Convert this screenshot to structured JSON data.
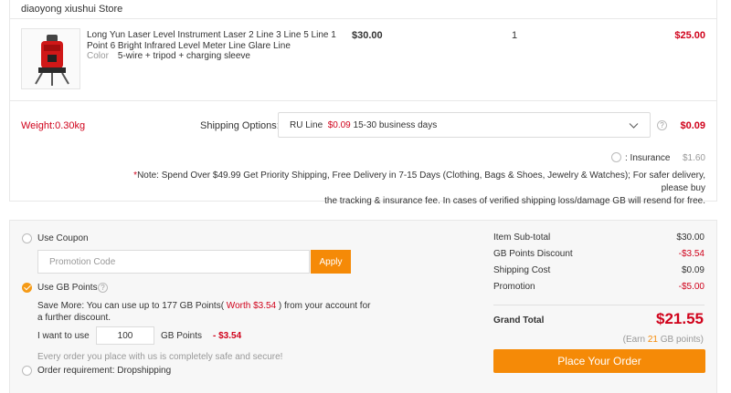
{
  "store": {
    "name": "diaoyong xiushui Store"
  },
  "product": {
    "title": "Long Yun Laser Level Instrument Laser 2 Line 3 Line 5 Line 1 Point 6 Bright Infrared Level Meter Line Glare Line",
    "option_label": "Color",
    "option_value": "5-wire + tripod + charging sleeve",
    "price": "$30.00",
    "quantity": "1",
    "total": "$25.00",
    "thumbnail_icon": "laser-level-image"
  },
  "shipping": {
    "weight": "Weight:0.30kg",
    "label": "Shipping Options:",
    "method": "RU Line",
    "method_price": "$0.09",
    "method_days": "15-30 business days",
    "cost": "$0.09",
    "insurance_label": ": Insurance",
    "insurance_cost": "$1.60",
    "note_asterisk": "*",
    "note_line1": "Note: Spend Over $49.99 Get Priority Shipping, Free Delivery in 7-15 Days (Clothing, Bags & Shoes, Jewelry & Watches); For safer delivery, please buy",
    "note_line2": "the tracking & insurance fee. In cases of verified shipping loss/damage GB will resend for free."
  },
  "coupon": {
    "label": "Use Coupon",
    "placeholder": "Promotion Code",
    "apply": "Apply"
  },
  "gb_points": {
    "label": "Use GB Points",
    "save_prefix": "Save More: You can use up to 177 GB Points(",
    "save_worth": " Worth $3.54 ",
    "save_suffix": ") from your account for",
    "save_line2": "a further discount.",
    "want_label": "I want to use",
    "value": "100",
    "unit": "GB Points",
    "discount": "- $3.54"
  },
  "safe_text": "Every order you place with us is completely safe and secure!",
  "dropship_label": "Order requirement: Dropshipping",
  "summary": {
    "subtotal_label": "Item Sub-total",
    "subtotal": "$30.00",
    "points_label": "GB Points Discount",
    "points": "-$3.54",
    "shipping_label": "Shipping Cost",
    "shipping": "$0.09",
    "promotion_label": "Promotion",
    "promotion": "-$5.00",
    "grand_label": "Grand Total",
    "grand": "$21.55",
    "earn_prefix": "(Earn ",
    "earn_points": "21",
    "earn_suffix": " GB points)",
    "place_order": "Place Your Order"
  },
  "colors": {
    "accent": "#f58a07",
    "price_red": "#d0021b"
  }
}
